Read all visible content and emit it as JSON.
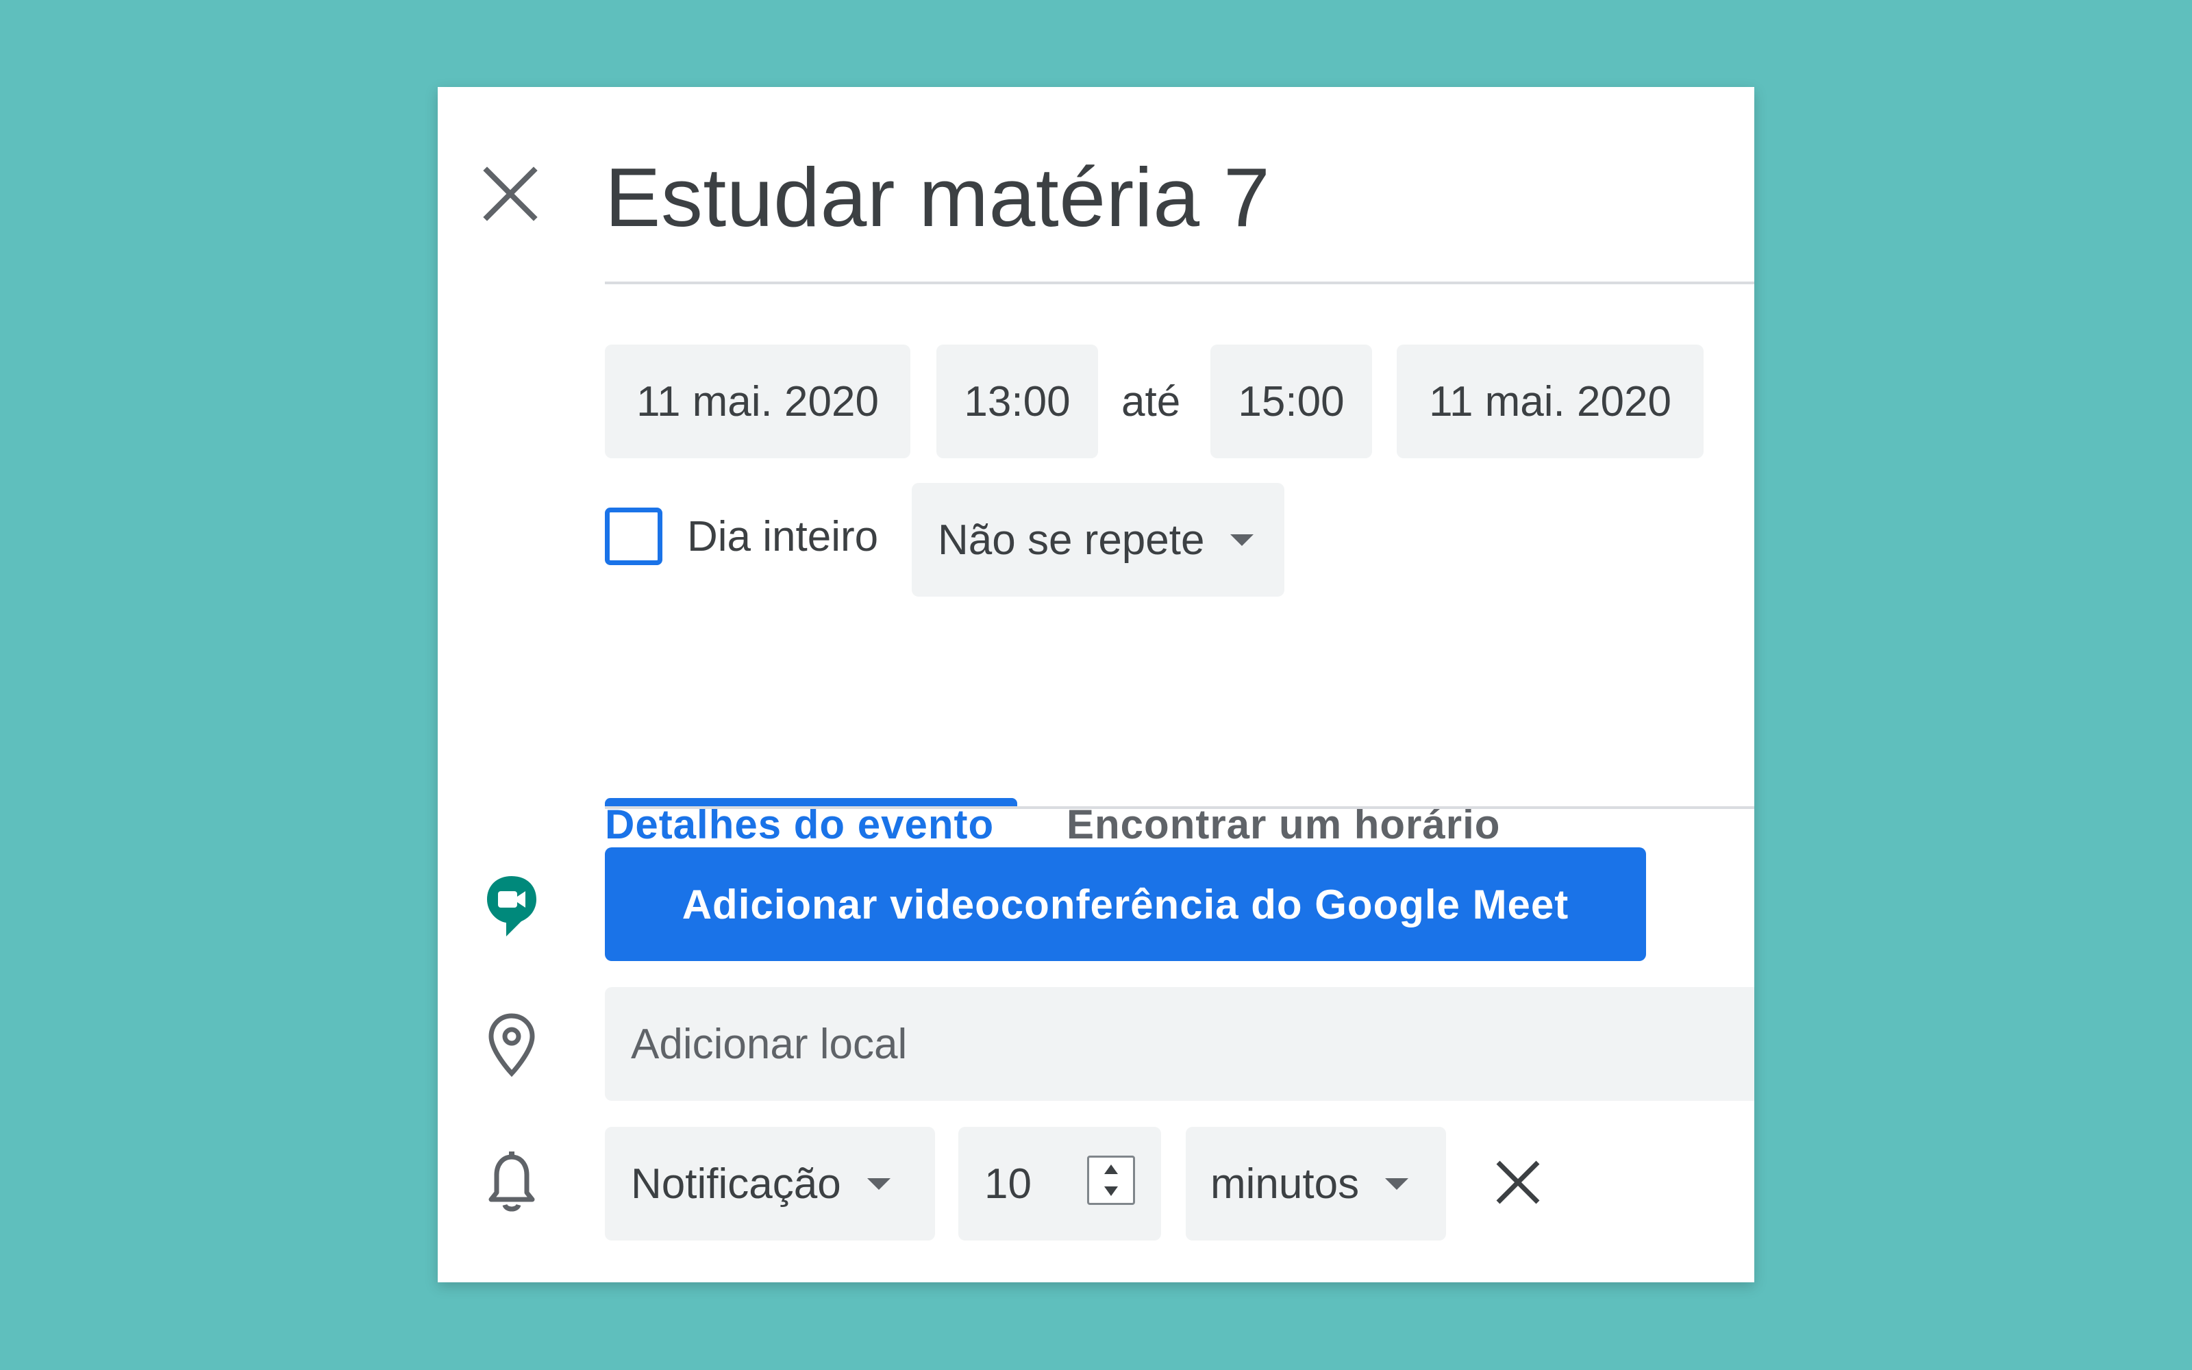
{
  "event": {
    "title": "Estudar matéria 7"
  },
  "datetime": {
    "start_date": "11 mai. 2020",
    "start_time": "13:00",
    "until_label": "até",
    "end_time": "15:00",
    "end_date": "11 mai. 2020",
    "all_day_label": "Dia inteiro",
    "all_day_checked": false,
    "repeat_selected": "Não se repete"
  },
  "tabs": [
    {
      "label": "Detalhes do evento",
      "active": true
    },
    {
      "label": "Encontrar um horário",
      "active": false
    }
  ],
  "meet": {
    "button_label": "Adicionar videoconferência do Google Meet"
  },
  "location": {
    "placeholder": "Adicionar local"
  },
  "notification": {
    "type_selected": "Notificação",
    "value": "10",
    "unit_selected": "minutos"
  },
  "icons": {
    "close": "close-icon",
    "meet": "google-meet-icon",
    "location": "map-pin-icon",
    "notification": "bell-icon",
    "remove_notification": "close-icon"
  },
  "colors": {
    "background": "#5fbfbd",
    "accent": "#1a73e8",
    "meet_green": "#00897b",
    "chip_bg": "#f1f3f4",
    "text": "#3c4043"
  }
}
